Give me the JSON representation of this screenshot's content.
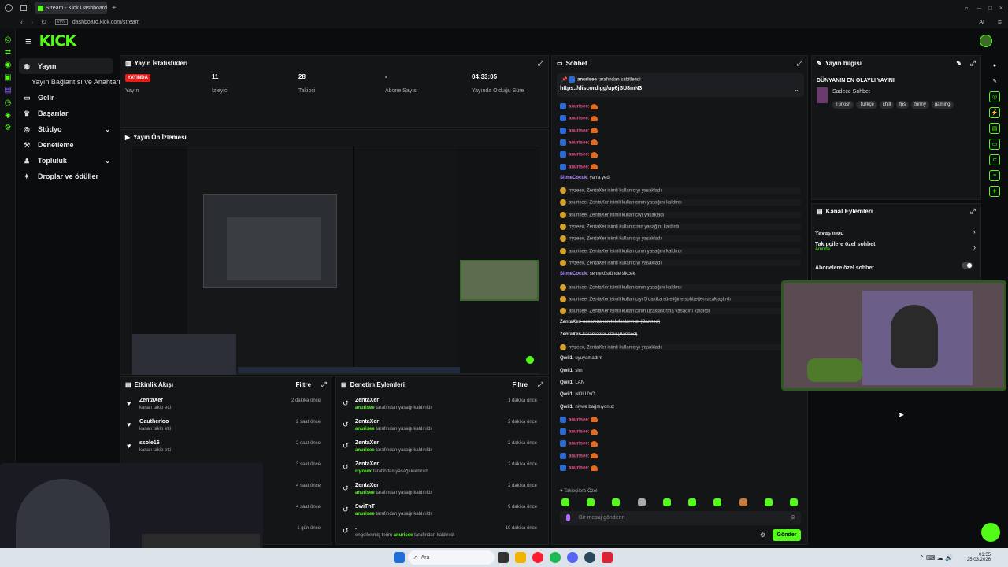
{
  "browser": {
    "tab_title": "Stream - Kick Dashboard",
    "url": "dashboard.kick.com/stream",
    "vpn_label": "VPN",
    "ai_label": "AI"
  },
  "header": {
    "logo": "KICK"
  },
  "sidebar": {
    "items": [
      {
        "label": "Yayın",
        "icon": "broadcast-icon"
      },
      {
        "label": "Yayın Bağlantısı ve Anahtarı",
        "icon": ""
      },
      {
        "label": "Gelir",
        "icon": "wallet-icon"
      },
      {
        "label": "Başarılar",
        "icon": "trophy-icon"
      },
      {
        "label": "Stüdyo",
        "icon": "studio-icon"
      },
      {
        "label": "Denetleme",
        "icon": "hammer-icon"
      },
      {
        "label": "Topluluk",
        "icon": "community-icon"
      },
      {
        "label": "Droplar ve ödüller",
        "icon": "gift-icon"
      }
    ]
  },
  "stats": {
    "title": "Yayın İstatistikleri",
    "live_badge": "YAYINDA",
    "live_label": "Yayın",
    "viewers_value": "11",
    "viewers_label": "İzleyici",
    "followers_value": "28",
    "followers_label": "Takipçi",
    "subs_value": "-",
    "subs_label": "Abone Sayısı",
    "uptime_value": "04:33:05",
    "uptime_label": "Yayında Olduğu Süre"
  },
  "preview": {
    "title": "Yayın Ön İzlemesi"
  },
  "activity": {
    "title": "Etkinlik Akışı",
    "filter": "Filtre",
    "rows": [
      {
        "name": "ZentaXer",
        "sub": "kanalı takip etti",
        "time": "2 dakika önce"
      },
      {
        "name": "Gautherloo",
        "sub": "kanalı takip etti",
        "time": "2 saat önce"
      },
      {
        "name": "ssole16",
        "sub": "kanalı takip etti",
        "time": "2 saat önce"
      },
      {
        "name": "",
        "sub": "",
        "time": "3 saat önce"
      },
      {
        "name": "",
        "sub": "",
        "time": "4 saat önce"
      },
      {
        "name": "",
        "sub": "",
        "time": "4 saat önce"
      },
      {
        "name": "",
        "sub": "",
        "time": "1 gün önce"
      }
    ]
  },
  "moderation": {
    "title": "Denetim Eylemleri",
    "filter": "Filtre",
    "rows": [
      {
        "name": "ZentaXer",
        "actor": "anurisee",
        "sub": "tarafından yasağı kaldırıldı",
        "time": "1 dakika önce"
      },
      {
        "name": "ZentaXer",
        "actor": "anurisee",
        "sub": "tarafından yasağı kaldırıldı",
        "time": "2 dakika önce"
      },
      {
        "name": "ZentaXer",
        "actor": "anurisee",
        "sub": "tarafından yasağı kaldırıldı",
        "time": "2 dakika önce"
      },
      {
        "name": "ZentaXer",
        "actor": "rryzeex",
        "sub": "tarafından yasağı kaldırıldı",
        "time": "2 dakika önce"
      },
      {
        "name": "ZentaXer",
        "actor": "anurisee",
        "sub": "tarafından yasağı kaldırıldı",
        "time": "2 dakika önce"
      },
      {
        "name": "SwiTnT",
        "actor": "anurisee",
        "sub": "tarafından yasağı kaldırıldı",
        "time": "9 dakika önce"
      },
      {
        "name": ".",
        "actor": "anurisee",
        "sub": "engellenmiş terim",
        "sub2": "tarafından kaldırıldı",
        "time": "10 dakika önce"
      }
    ]
  },
  "chat": {
    "title": "Sohbet",
    "pinned_by_user": "anurisee",
    "pinned_by_text": "tarafından sabitlendi",
    "pinned_link": "https://discord.gg/up6jSU8mN3",
    "lines": [
      {
        "type": "msg",
        "user": "anurisee",
        "text": ":",
        "emote": true
      },
      {
        "type": "msg",
        "user": "anurisee",
        "text": ":",
        "emote": true
      },
      {
        "type": "msg",
        "user": "anurisee",
        "text": ":",
        "emote": true
      },
      {
        "type": "msg",
        "user": "anurisee",
        "text": ":",
        "emote": true
      },
      {
        "type": "msg",
        "user": "anurisee",
        "text": ":",
        "emote": true
      },
      {
        "type": "msg",
        "user": "anurisee",
        "text": ":",
        "emote": true
      },
      {
        "type": "user",
        "user": "SlimeCocuk",
        "text": ": yarra yedi"
      },
      {
        "type": "sys",
        "text": "rryzeex, ZentaXer isimli kullanıcıyı yasakladı"
      },
      {
        "type": "sys",
        "text": "anurisee, ZentaXer isimli kullanıcının yasağını kaldırdı"
      },
      {
        "type": "sys",
        "text": "anurisee, ZentaXer isimli kullanıcıyı yasakladı"
      },
      {
        "type": "sys",
        "text": "rryzeex, ZentaXer isimli kullanıcının yasağını kaldırdı"
      },
      {
        "type": "sys",
        "text": "rryzeex, ZentaXer isimli kullanıcıyı yasakladı"
      },
      {
        "type": "sys",
        "text": "anurisee, ZentaXer isimli kullanıcının yasağını kaldırdı"
      },
      {
        "type": "sys",
        "text": "rryzeex, ZentaXer isimli kullanıcıyı yasakladı"
      },
      {
        "type": "user",
        "user": "SlimeCocuk",
        "text": ": şehreküstünde sikcek"
      },
      {
        "type": "sys",
        "text": "anurisee, ZentaXer isimli kullanıcının yasağını kaldırdı"
      },
      {
        "type": "sys",
        "text": "anurisee, ZentaXer isimli kullanıcıyı 5 dakika süreliğine sohbetten uzaklaştırdı"
      },
      {
        "type": "sys",
        "text": "anurisee, ZentaXer isimli kullanıcının uzaklaştırma yasağını kaldırdı"
      },
      {
        "type": "user",
        "user": "ZentaXer",
        "text": ": acsanıza ıan telefonlarınızı (Banned)"
      },
      {
        "type": "user",
        "user": "ZentaXer",
        "text": ": karamanlar siziii (Banned)"
      },
      {
        "type": "sys",
        "text": "rryzeex, ZentaXer isimli kullanıcıyı yasakladı"
      },
      {
        "type": "user",
        "user": "Qwil1",
        "text": ": uyuyamadım",
        "white": true
      },
      {
        "type": "user",
        "user": "Qwil1",
        "text": ": sim",
        "white": true
      },
      {
        "type": "user",
        "user": "Qwil1",
        "text": ": LAN",
        "white": true
      },
      {
        "type": "user",
        "user": "Qwil1",
        "text": ": NOLUYO",
        "white": true
      },
      {
        "type": "user",
        "user": "Qwil1",
        "text": ": niywe bağmıyonuz",
        "white": true
      },
      {
        "type": "msg",
        "user": "anurisee",
        "text": ":",
        "emote": true
      },
      {
        "type": "msg",
        "user": "anurisee",
        "text": ":",
        "emote": true
      },
      {
        "type": "msg",
        "user": "anurisee",
        "text": ":",
        "emote": true
      },
      {
        "type": "msg",
        "user": "anurisee",
        "text": ":",
        "emote": true
      },
      {
        "type": "msg",
        "user": "anurisee",
        "text": ":",
        "emote": true
      }
    ],
    "followers_only": "Takipçilere Özel",
    "input_placeholder": "Bir mesaj gönderin",
    "send_label": "Gönder"
  },
  "info": {
    "title": "Yayın bilgisi",
    "stream_title": "DÜNYANIN EN OLAYLI YAYINI",
    "category": "Sadece Sohbet",
    "tags": [
      "Turkish",
      "Türkçe",
      "chill",
      "fps",
      "funny",
      "gaming"
    ]
  },
  "channel_actions": {
    "title": "Kanal Eylemleri",
    "slow_mode": "Yavaş mod",
    "followers_chat": "Takipçilere özel sohbet",
    "followers_chat_sub": "Anında",
    "subs_chat": "Abonelere özel sohbet"
  },
  "taskbar": {
    "search": "Ara",
    "time": "01:55",
    "date": "25.03.2026"
  },
  "colors": {
    "accent": "#53fc18",
    "live": "#e91916",
    "bg": "#0b0c0d",
    "panel": "#141517"
  }
}
